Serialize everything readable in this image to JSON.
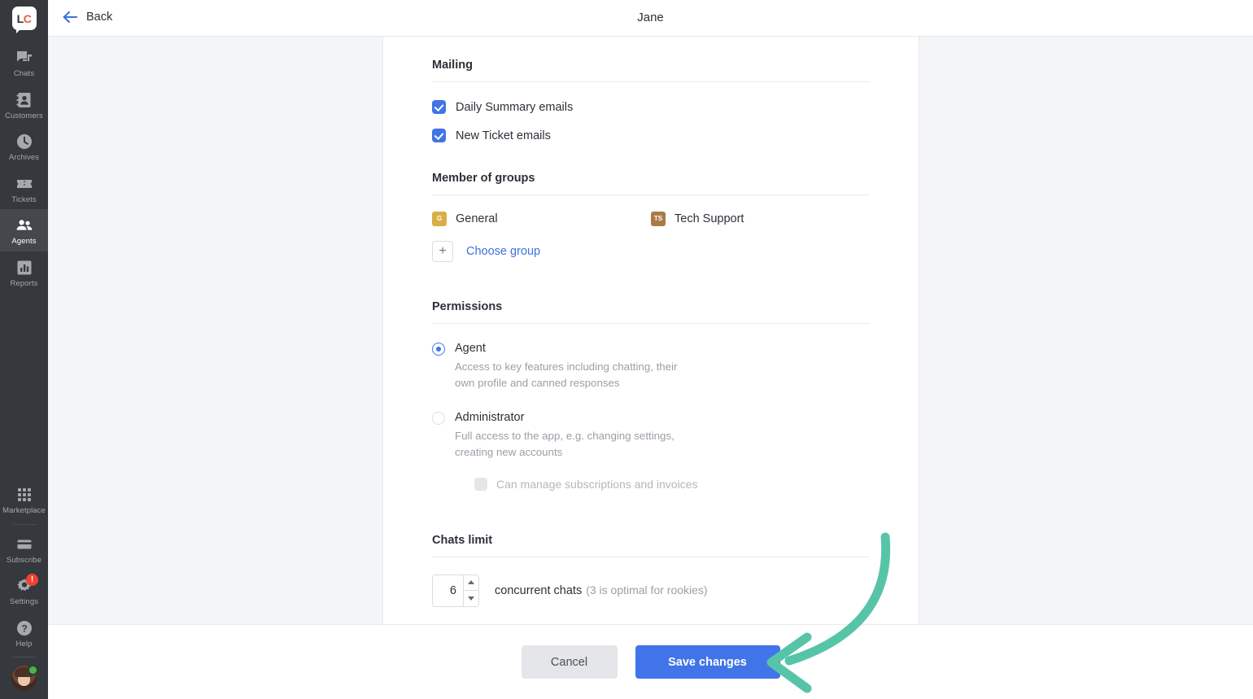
{
  "sidebar": {
    "logo": {
      "text_left": "LC",
      "left": "L",
      "right": "C",
      "name": "livechat-logo"
    },
    "items": [
      {
        "label": "Chats",
        "icon": "chats-icon",
        "active": false
      },
      {
        "label": "Customers",
        "icon": "customers-icon",
        "active": false
      },
      {
        "label": "Archives",
        "icon": "archives-icon",
        "active": false
      },
      {
        "label": "Tickets",
        "icon": "tickets-icon",
        "active": false
      },
      {
        "label": "Agents",
        "icon": "agents-icon",
        "active": true
      },
      {
        "label": "Reports",
        "icon": "reports-icon",
        "active": false
      }
    ],
    "bottom_items": [
      {
        "label": "Marketplace",
        "icon": "marketplace-icon",
        "badge": ""
      },
      {
        "label": "Subscribe",
        "icon": "subscribe-icon",
        "badge": ""
      },
      {
        "label": "Settings",
        "icon": "gear-icon",
        "badge": "!"
      },
      {
        "label": "Help",
        "icon": "help-icon",
        "badge": ""
      }
    ],
    "avatar": {
      "name": "user-avatar",
      "presence": "online"
    },
    "colors": {
      "background": "#35383d",
      "active_background": "#44474c",
      "label": "#a5a8ad",
      "badge": "#ef4230"
    }
  },
  "header": {
    "back_label": "Back",
    "title": "Jane"
  },
  "main": {
    "mailing": {
      "title": "Mailing",
      "options": [
        {
          "label": "Daily Summary emails",
          "checked": true
        },
        {
          "label": "New Ticket emails",
          "checked": true
        }
      ]
    },
    "groups": {
      "title": "Member of groups",
      "items": [
        {
          "name": "General",
          "initials": "G",
          "color": "#d9ae45"
        },
        {
          "name": "Tech Support",
          "initials": "TS",
          "color": "#a97b46"
        }
      ],
      "add_label": "Choose group",
      "add_icon": "plus-icon"
    },
    "permissions": {
      "title": "Permissions",
      "options": [
        {
          "label": "Agent",
          "description": "Access to key features including chatting, their own profile and canned responses",
          "selected": true
        },
        {
          "label": "Administrator",
          "description": "Full access to the app, e.g. changing settings, creating new accounts",
          "selected": false
        }
      ],
      "sub_option": {
        "label": "Can manage subscriptions and invoices",
        "checked": false,
        "disabled": true
      }
    },
    "chats_limit": {
      "title": "Chats limit",
      "value": "6",
      "unit_label": "concurrent chats",
      "hint": "(3 is optimal for rookies)"
    }
  },
  "footer": {
    "cancel_label": "Cancel",
    "save_label": "Save changes"
  },
  "annotation": {
    "type": "curved-arrow",
    "points_to": "save-button",
    "color": "#57c4a8"
  }
}
